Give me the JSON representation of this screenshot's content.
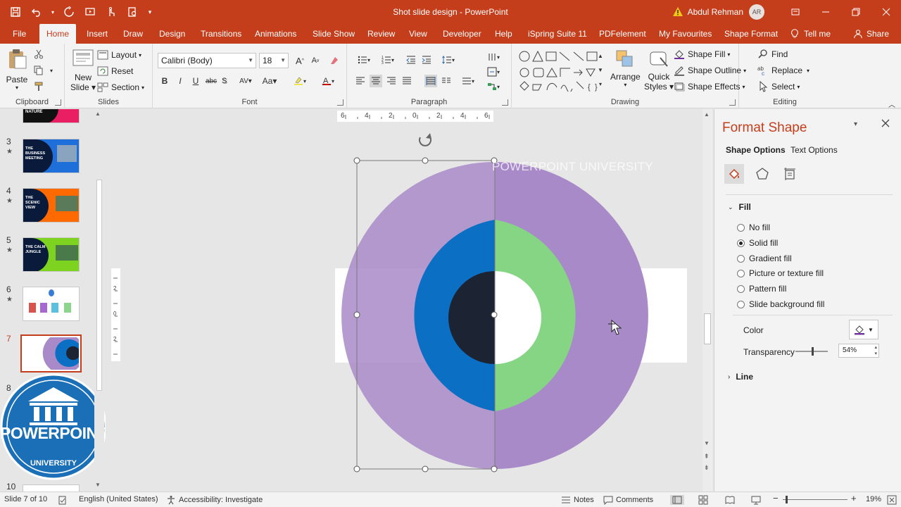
{
  "window": {
    "title": "Shot slide design",
    "app_name": "PowerPoint",
    "user": "Abdul Rehman",
    "user_initials": "AR",
    "share_label": "Share",
    "tell_me_label": "Tell me"
  },
  "tabs": [
    "File",
    "Home",
    "Insert",
    "Draw",
    "Design",
    "Transitions",
    "Animations",
    "Slide Show",
    "Review",
    "View",
    "Developer",
    "Help",
    "iSpring Suite 11",
    "PDFelement",
    "My Favourites",
    "Shape Format"
  ],
  "ribbon": {
    "clipboard": {
      "label": "Clipboard",
      "paste": "Paste"
    },
    "slides": {
      "label": "Slides",
      "new_slide_line1": "New",
      "new_slide_line2": "Slide",
      "layout": "Layout",
      "reset": "Reset",
      "section": "Section"
    },
    "font": {
      "label": "Font",
      "font_name": "Calibri (Body)",
      "font_size": "18",
      "bold": "B",
      "italic": "I",
      "underline": "U",
      "strike": "abc",
      "spacing": "AV",
      "case": "Aa"
    },
    "paragraph": {
      "label": "Paragraph"
    },
    "drawing": {
      "label": "Drawing",
      "arrange": "Arrange",
      "quick_styles_line1": "Quick",
      "quick_styles_line2": "Styles",
      "shape_fill": "Shape Fill",
      "shape_outline": "Shape Outline",
      "shape_effects": "Shape Effects"
    },
    "editing": {
      "label": "Editing",
      "find": "Find",
      "replace": "Replace",
      "select": "Select"
    }
  },
  "thumbnails": [
    {
      "num": "3",
      "star": "★",
      "text": "THE BUSINESS MEETING",
      "color": "#1e6fd9"
    },
    {
      "num": "4",
      "star": "★",
      "text": "THE SCENIC VIEW",
      "color": "#ff6a00"
    },
    {
      "num": "5",
      "star": "★",
      "text": "THE CALM JUNGLE",
      "color": "#7ed321"
    },
    {
      "num": "6",
      "star": "★"
    },
    {
      "num": "7"
    },
    {
      "num": "8"
    },
    {
      "num": "10"
    }
  ],
  "thumb_top_text": "NATURE",
  "slide": {
    "watermark": "POWERPOINT UNIVERSITY",
    "logo_line1": "POWERPOINT",
    "logo_line2": "UNIVERSITY"
  },
  "ruler": {
    "horizontal": [
      "6",
      "4",
      "2",
      "0",
      "2",
      "4",
      "6"
    ],
    "vertical": [
      "2",
      "0",
      "2"
    ]
  },
  "pane": {
    "title": "Format Shape",
    "tab_shape": "Shape Options",
    "tab_text": "Text Options",
    "fill_header": "Fill",
    "fill_options": [
      "No fill",
      "Solid fill",
      "Gradient fill",
      "Picture or texture fill",
      "Pattern fill",
      "Slide background fill"
    ],
    "selected_fill": "Solid fill",
    "color_label": "Color",
    "transparency_label": "Transparency",
    "transparency_value": "54%",
    "transparency": 0.54,
    "line_header": "Line"
  },
  "status": {
    "slide_info": "Slide 7 of 10",
    "language": "English (United States)",
    "accessibility": "Accessibility: Investigate",
    "notes": "Notes",
    "comments": "Comments",
    "zoom": "19%"
  },
  "colors": {
    "accent": "#c43e1c",
    "outer_ring": "#a98ac9",
    "blue_ring": "#0b6fc4",
    "green_ring": "#86d584",
    "dark_core": "#1c2333",
    "fill_color": "#7030a0"
  }
}
